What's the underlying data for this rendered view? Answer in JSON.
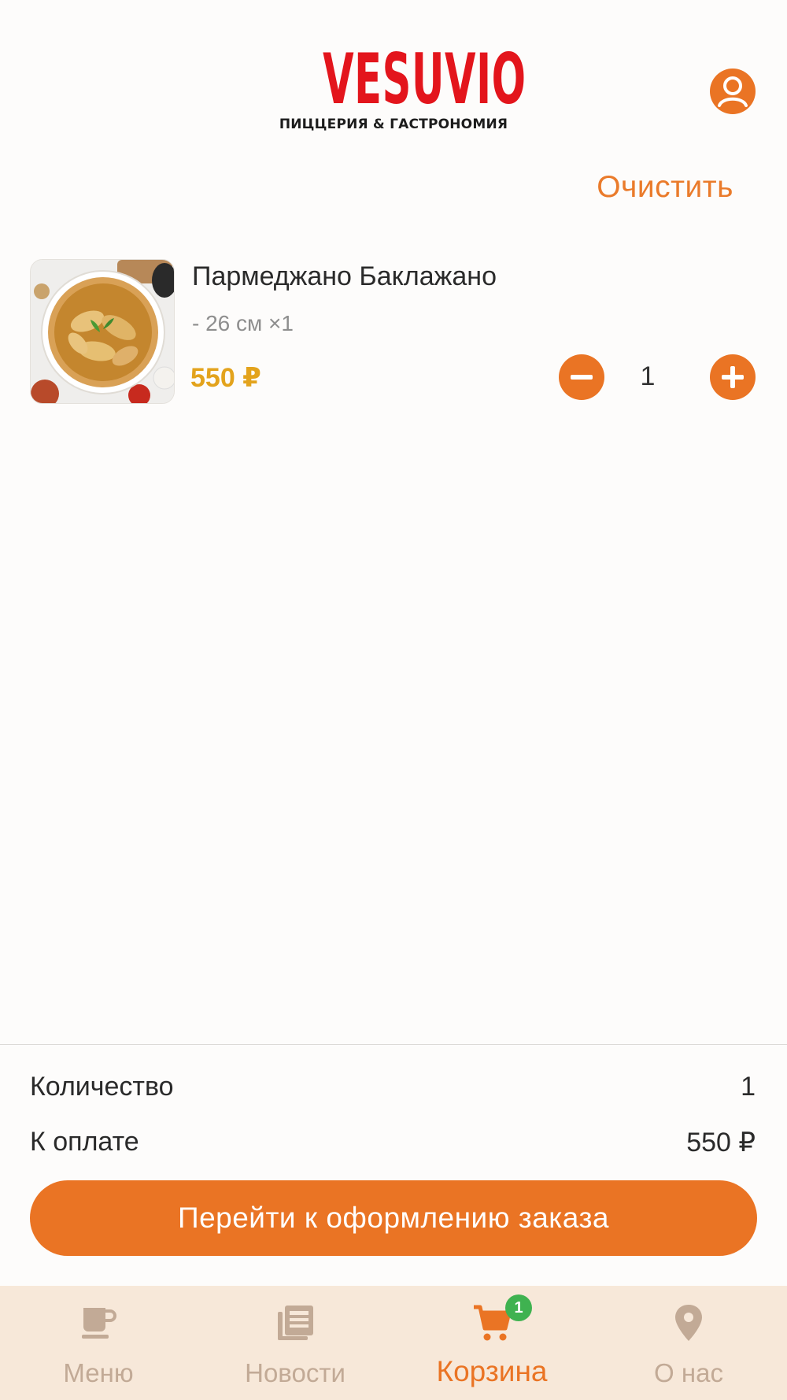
{
  "header": {
    "logo_word": "VESUVIO",
    "logo_subtitle": "ПИЦЦЕРИЯ & ГАСТРОНОМИЯ",
    "profile_icon": "user-circle-icon"
  },
  "cart": {
    "clear_label": "Очистить",
    "items": [
      {
        "name": "Пармеджано Баклажано",
        "variant": "- 26 см ×1",
        "price": "550 ₽",
        "quantity": "1",
        "thumbnail_icon": "pizza-photo"
      }
    ]
  },
  "summary": {
    "quantity_label": "Количество",
    "quantity_value": "1",
    "total_label": "К оплате",
    "total_value": "550 ₽",
    "checkout_label": "Перейти к оформлению заказа"
  },
  "nav": {
    "items": [
      {
        "label": "Меню",
        "icon": "coffee-cup-icon",
        "active": false
      },
      {
        "label": "Новости",
        "icon": "newspaper-icon",
        "active": false
      },
      {
        "label": "Корзина",
        "icon": "cart-icon",
        "active": true,
        "badge": "1"
      },
      {
        "label": "О нас",
        "icon": "map-pin-icon",
        "active": false
      }
    ]
  },
  "colors": {
    "accent": "#ea7424",
    "brand_red": "#e3151c",
    "price": "#e3a31c",
    "nav_bg": "#f7e8d9",
    "nav_inactive": "#c2aa96",
    "badge": "#3fb250"
  }
}
